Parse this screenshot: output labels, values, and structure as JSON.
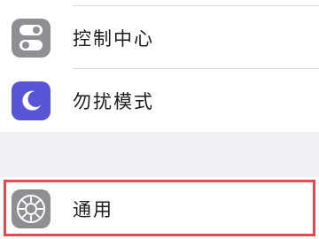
{
  "settings": {
    "items": [
      {
        "label": "控制中心",
        "icon": "control-center-icon",
        "icon_bg": "#8e8e93"
      },
      {
        "label": "勿扰模式",
        "icon": "moon-icon",
        "icon_bg": "#5856d6"
      },
      {
        "label": "通用",
        "icon": "gear-icon",
        "icon_bg": "#8e8e93"
      }
    ]
  },
  "colors": {
    "group_background": "#efeff4",
    "cell_background": "#ffffff",
    "highlight_border": "#e5484d"
  }
}
